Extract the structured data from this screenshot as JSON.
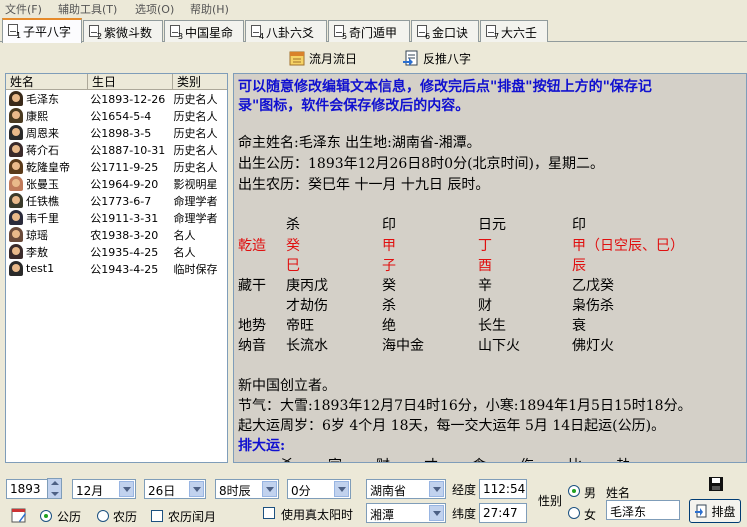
{
  "menu": [
    "文件(F)",
    "辅助工具(T)",
    "选项(O)",
    "帮助(H)"
  ],
  "tabs": [
    {
      "num": "1",
      "label": "子平八字"
    },
    {
      "num": "2",
      "label": "紫微斗数"
    },
    {
      "num": "3",
      "label": "中国星命"
    },
    {
      "num": "4",
      "label": "八卦六爻"
    },
    {
      "num": "5",
      "label": "奇门遁甲"
    },
    {
      "num": "6",
      "label": "金口诀"
    },
    {
      "num": "7",
      "label": "大六壬"
    }
  ],
  "toolbar": {
    "liuyue": "流月流日",
    "fantui": "反推八字"
  },
  "list": {
    "headers": [
      "姓名",
      "生日",
      "类别"
    ],
    "rows": [
      {
        "name": "毛泽东",
        "birth": "公1893-12-26",
        "type": "历史名人"
      },
      {
        "name": "康熙",
        "birth": "公1654-5-4",
        "type": "历史名人"
      },
      {
        "name": "周恩来",
        "birth": "公1898-3-5",
        "type": "历史名人"
      },
      {
        "name": "蒋介石",
        "birth": "公1887-10-31",
        "type": "历史名人"
      },
      {
        "name": "乾隆皇帝",
        "birth": "公1711-9-25",
        "type": "历史名人"
      },
      {
        "name": "张曼玉",
        "birth": "公1964-9-20",
        "type": "影视明星"
      },
      {
        "name": "任铁樵",
        "birth": "公1773-6-7",
        "type": "命理学者"
      },
      {
        "name": "韦千里",
        "birth": "公1911-3-31",
        "type": "命理学者"
      },
      {
        "name": "琼瑶",
        "birth": "农1938-3-20",
        "type": "名人"
      },
      {
        "name": "李敖",
        "birth": "公1935-4-25",
        "type": "名人"
      },
      {
        "name": "test1",
        "birth": "公1943-4-25",
        "type": "临时保存"
      }
    ]
  },
  "text": {
    "notice1": "可以随意修改编辑文本信息，修改完后点\"排盘\"按钮上方的\"保存记",
    "notice2": "录\"图标，软件会保存修改后的内容。",
    "name_line": "命主姓名:毛泽东   出生地:湖南省-湘潭。",
    "solar_line": "出生公历：1893年12月26日8时0分(北京时间)，星期二。",
    "lunar_line": "出生农历：癸巳年 十一月 十九日 辰时。",
    "chart": {
      "qianzao": "乾造",
      "shishen": [
        "杀",
        "印",
        "日元",
        "印"
      ],
      "gan": [
        "癸",
        "甲",
        "丁",
        "甲（日空辰、巳）"
      ],
      "zhi": [
        "巳",
        "子",
        "酉",
        "辰"
      ],
      "canggan_label": "藏干",
      "canggan": [
        "庚丙戊",
        "癸",
        "辛",
        "乙戊癸"
      ],
      "canggan_ss": [
        "才劫伤",
        "杀",
        "财",
        "枭伤杀"
      ],
      "dishi_label": "地势",
      "dishi": [
        "帝旺",
        "绝",
        "长生",
        "衰"
      ],
      "nayin_label": "纳音",
      "nayin": [
        "长流水",
        "海中金",
        "山下火",
        "佛灯火"
      ]
    },
    "note": "新中国创立者。",
    "jieqi": "节气：大雪:1893年12月7日4时16分，小寒:1894年1月5日15时18分。",
    "qiyun": "起大运周岁：6岁 4个月 18天，每一交大运年 5月 14日起运(公历)。",
    "dayun_title": "排大运:",
    "dayun_ss": [
      "杀",
      "官",
      "财",
      "才",
      "食",
      "伤",
      "比",
      "劫"
    ]
  },
  "form": {
    "year": "1893",
    "month": "12月",
    "day": "26日",
    "hour": "8时辰",
    "minute": "0分",
    "province": "湖南省",
    "city": "湘潭",
    "longitude_label": "经度",
    "longitude": "112:54",
    "latitude_label": "纬度",
    "latitude": "27:47",
    "gender_label": "性别",
    "male": "男",
    "female": "女",
    "name_label": "姓名",
    "name_value": "毛泽东",
    "solar": "公历",
    "lunar": "农历",
    "leap": "农历闰月",
    "true_solar": "使用真太阳时",
    "paipan": "排盘"
  },
  "colors": {
    "blue_text": "#1010d0",
    "red_text": "#e01010",
    "tab_accent": "#e68b2c"
  }
}
